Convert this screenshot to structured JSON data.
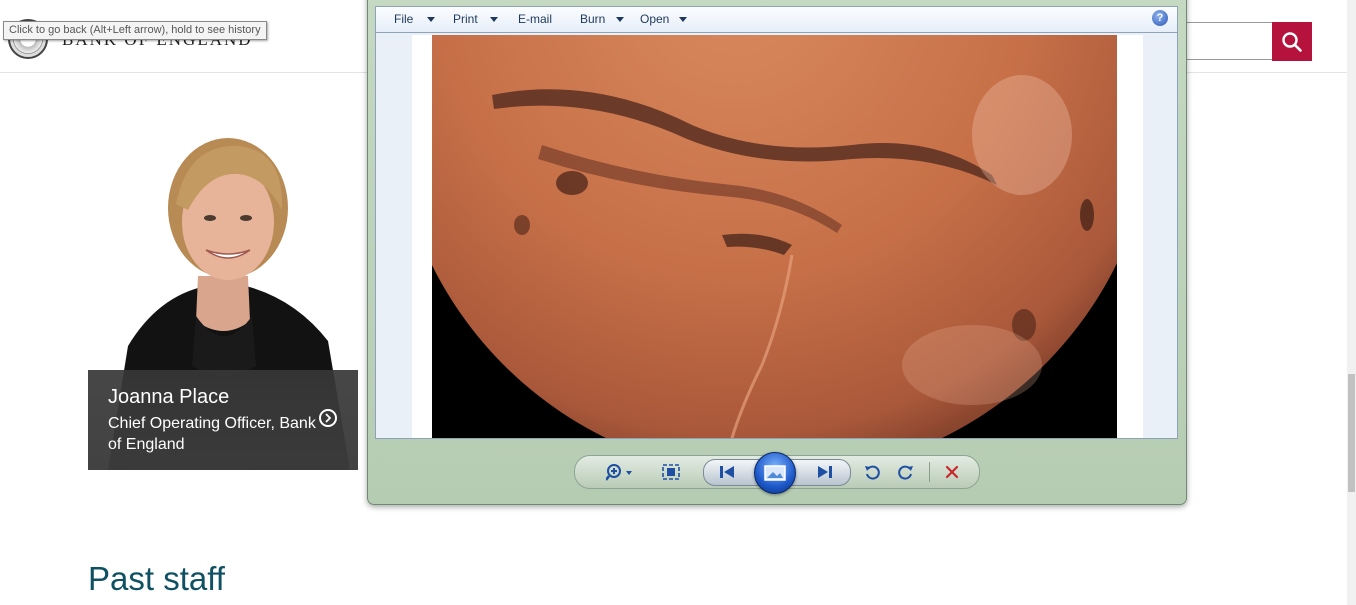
{
  "browser": {
    "back_tooltip": "Click to go back (Alt+Left arrow), hold to see history"
  },
  "site": {
    "name": "BANK OF ENGLAND",
    "search_placeholder": "",
    "search_icon": "magnifier-icon",
    "accent_color": "#b5123e"
  },
  "profile": {
    "name": "Joanna Place",
    "title": "Chief Operating Officer, Bank of England",
    "arrow_icon": "chevron-right-circle-icon"
  },
  "sections": {
    "past_staff": "Past staff"
  },
  "viewer": {
    "menu": [
      {
        "label": "File",
        "has_dropdown": true
      },
      {
        "label": "Print",
        "has_dropdown": true
      },
      {
        "label": "E-mail",
        "has_dropdown": false
      },
      {
        "label": "Burn",
        "has_dropdown": true
      },
      {
        "label": "Open",
        "has_dropdown": true
      }
    ],
    "help_label": "?",
    "image_subject": "Mars",
    "toolbar": [
      "zoom-icon",
      "actual-size-icon",
      "previous-icon",
      "slideshow-icon",
      "next-icon",
      "rotate-counterclockwise-icon",
      "rotate-clockwise-icon",
      "delete-icon"
    ]
  }
}
